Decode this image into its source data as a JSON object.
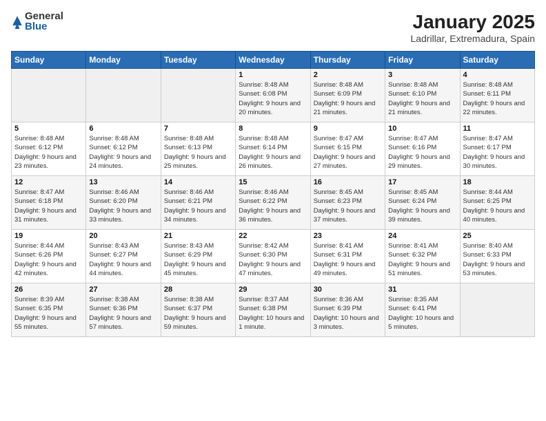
{
  "logo": {
    "general": "General",
    "blue": "Blue"
  },
  "calendar": {
    "title": "January 2025",
    "subtitle": "Ladrillar, Extremadura, Spain"
  },
  "headers": [
    "Sunday",
    "Monday",
    "Tuesday",
    "Wednesday",
    "Thursday",
    "Friday",
    "Saturday"
  ],
  "weeks": [
    [
      {
        "day": "",
        "sunrise": "",
        "sunset": "",
        "daylight": "",
        "empty": true
      },
      {
        "day": "",
        "sunrise": "",
        "sunset": "",
        "daylight": "",
        "empty": true
      },
      {
        "day": "",
        "sunrise": "",
        "sunset": "",
        "daylight": "",
        "empty": true
      },
      {
        "day": "1",
        "sunrise": "Sunrise: 8:48 AM",
        "sunset": "Sunset: 6:08 PM",
        "daylight": "Daylight: 9 hours and 20 minutes."
      },
      {
        "day": "2",
        "sunrise": "Sunrise: 8:48 AM",
        "sunset": "Sunset: 6:09 PM",
        "daylight": "Daylight: 9 hours and 21 minutes."
      },
      {
        "day": "3",
        "sunrise": "Sunrise: 8:48 AM",
        "sunset": "Sunset: 6:10 PM",
        "daylight": "Daylight: 9 hours and 21 minutes."
      },
      {
        "day": "4",
        "sunrise": "Sunrise: 8:48 AM",
        "sunset": "Sunset: 6:11 PM",
        "daylight": "Daylight: 9 hours and 22 minutes."
      }
    ],
    [
      {
        "day": "5",
        "sunrise": "Sunrise: 8:48 AM",
        "sunset": "Sunset: 6:12 PM",
        "daylight": "Daylight: 9 hours and 23 minutes."
      },
      {
        "day": "6",
        "sunrise": "Sunrise: 8:48 AM",
        "sunset": "Sunset: 6:12 PM",
        "daylight": "Daylight: 9 hours and 24 minutes."
      },
      {
        "day": "7",
        "sunrise": "Sunrise: 8:48 AM",
        "sunset": "Sunset: 6:13 PM",
        "daylight": "Daylight: 9 hours and 25 minutes."
      },
      {
        "day": "8",
        "sunrise": "Sunrise: 8:48 AM",
        "sunset": "Sunset: 6:14 PM",
        "daylight": "Daylight: 9 hours and 26 minutes."
      },
      {
        "day": "9",
        "sunrise": "Sunrise: 8:47 AM",
        "sunset": "Sunset: 6:15 PM",
        "daylight": "Daylight: 9 hours and 27 minutes."
      },
      {
        "day": "10",
        "sunrise": "Sunrise: 8:47 AM",
        "sunset": "Sunset: 6:16 PM",
        "daylight": "Daylight: 9 hours and 29 minutes."
      },
      {
        "day": "11",
        "sunrise": "Sunrise: 8:47 AM",
        "sunset": "Sunset: 6:17 PM",
        "daylight": "Daylight: 9 hours and 30 minutes."
      }
    ],
    [
      {
        "day": "12",
        "sunrise": "Sunrise: 8:47 AM",
        "sunset": "Sunset: 6:18 PM",
        "daylight": "Daylight: 9 hours and 31 minutes."
      },
      {
        "day": "13",
        "sunrise": "Sunrise: 8:46 AM",
        "sunset": "Sunset: 6:20 PM",
        "daylight": "Daylight: 9 hours and 33 minutes."
      },
      {
        "day": "14",
        "sunrise": "Sunrise: 8:46 AM",
        "sunset": "Sunset: 6:21 PM",
        "daylight": "Daylight: 9 hours and 34 minutes."
      },
      {
        "day": "15",
        "sunrise": "Sunrise: 8:46 AM",
        "sunset": "Sunset: 6:22 PM",
        "daylight": "Daylight: 9 hours and 36 minutes."
      },
      {
        "day": "16",
        "sunrise": "Sunrise: 8:45 AM",
        "sunset": "Sunset: 6:23 PM",
        "daylight": "Daylight: 9 hours and 37 minutes."
      },
      {
        "day": "17",
        "sunrise": "Sunrise: 8:45 AM",
        "sunset": "Sunset: 6:24 PM",
        "daylight": "Daylight: 9 hours and 39 minutes."
      },
      {
        "day": "18",
        "sunrise": "Sunrise: 8:44 AM",
        "sunset": "Sunset: 6:25 PM",
        "daylight": "Daylight: 9 hours and 40 minutes."
      }
    ],
    [
      {
        "day": "19",
        "sunrise": "Sunrise: 8:44 AM",
        "sunset": "Sunset: 6:26 PM",
        "daylight": "Daylight: 9 hours and 42 minutes."
      },
      {
        "day": "20",
        "sunrise": "Sunrise: 8:43 AM",
        "sunset": "Sunset: 6:27 PM",
        "daylight": "Daylight: 9 hours and 44 minutes."
      },
      {
        "day": "21",
        "sunrise": "Sunrise: 8:43 AM",
        "sunset": "Sunset: 6:29 PM",
        "daylight": "Daylight: 9 hours and 45 minutes."
      },
      {
        "day": "22",
        "sunrise": "Sunrise: 8:42 AM",
        "sunset": "Sunset: 6:30 PM",
        "daylight": "Daylight: 9 hours and 47 minutes."
      },
      {
        "day": "23",
        "sunrise": "Sunrise: 8:41 AM",
        "sunset": "Sunset: 6:31 PM",
        "daylight": "Daylight: 9 hours and 49 minutes."
      },
      {
        "day": "24",
        "sunrise": "Sunrise: 8:41 AM",
        "sunset": "Sunset: 6:32 PM",
        "daylight": "Daylight: 9 hours and 51 minutes."
      },
      {
        "day": "25",
        "sunrise": "Sunrise: 8:40 AM",
        "sunset": "Sunset: 6:33 PM",
        "daylight": "Daylight: 9 hours and 53 minutes."
      }
    ],
    [
      {
        "day": "26",
        "sunrise": "Sunrise: 8:39 AM",
        "sunset": "Sunset: 6:35 PM",
        "daylight": "Daylight: 9 hours and 55 minutes."
      },
      {
        "day": "27",
        "sunrise": "Sunrise: 8:38 AM",
        "sunset": "Sunset: 6:36 PM",
        "daylight": "Daylight: 9 hours and 57 minutes."
      },
      {
        "day": "28",
        "sunrise": "Sunrise: 8:38 AM",
        "sunset": "Sunset: 6:37 PM",
        "daylight": "Daylight: 9 hours and 59 minutes."
      },
      {
        "day": "29",
        "sunrise": "Sunrise: 8:37 AM",
        "sunset": "Sunset: 6:38 PM",
        "daylight": "Daylight: 10 hours and 1 minute."
      },
      {
        "day": "30",
        "sunrise": "Sunrise: 8:36 AM",
        "sunset": "Sunset: 6:39 PM",
        "daylight": "Daylight: 10 hours and 3 minutes."
      },
      {
        "day": "31",
        "sunrise": "Sunrise: 8:35 AM",
        "sunset": "Sunset: 6:41 PM",
        "daylight": "Daylight: 10 hours and 5 minutes."
      },
      {
        "day": "",
        "sunrise": "",
        "sunset": "",
        "daylight": "",
        "empty": true
      }
    ]
  ]
}
